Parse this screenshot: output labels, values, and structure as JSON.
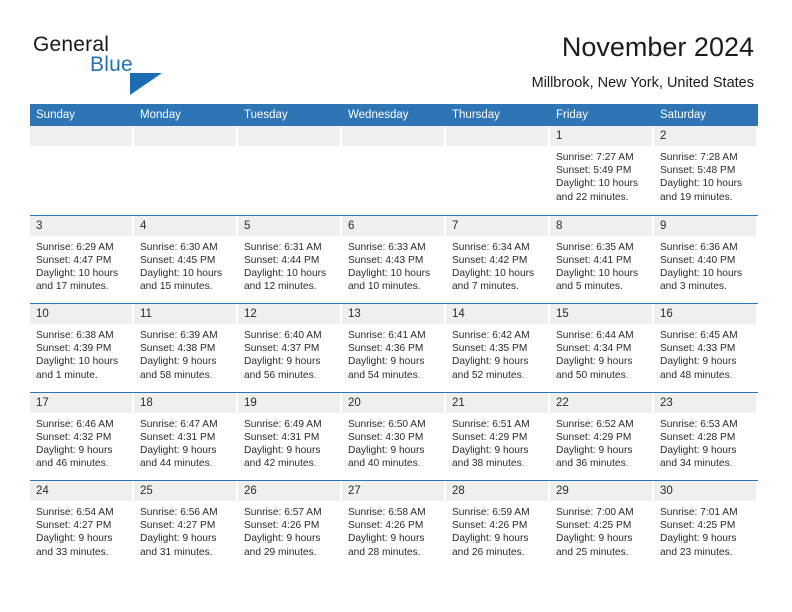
{
  "brand": {
    "name_part1": "General",
    "name_part2": "Blue"
  },
  "header": {
    "title": "November 2024",
    "location": "Millbrook, New York, United States"
  },
  "weekday_headers": [
    "Sunday",
    "Monday",
    "Tuesday",
    "Wednesday",
    "Thursday",
    "Friday",
    "Saturday"
  ],
  "colors": {
    "header_blue": "#2e75b6",
    "brand_blue": "#2272b5",
    "daynum_band": "#efefef",
    "text": "#2b2b2b"
  },
  "weeks": [
    [
      {
        "empty": true
      },
      {
        "empty": true
      },
      {
        "empty": true
      },
      {
        "empty": true
      },
      {
        "empty": true
      },
      {
        "day": "1",
        "sunrise": "Sunrise: 7:27 AM",
        "sunset": "Sunset: 5:49 PM",
        "daylight": "Daylight: 10 hours and 22 minutes."
      },
      {
        "day": "2",
        "sunrise": "Sunrise: 7:28 AM",
        "sunset": "Sunset: 5:48 PM",
        "daylight": "Daylight: 10 hours and 19 minutes."
      }
    ],
    [
      {
        "day": "3",
        "sunrise": "Sunrise: 6:29 AM",
        "sunset": "Sunset: 4:47 PM",
        "daylight": "Daylight: 10 hours and 17 minutes."
      },
      {
        "day": "4",
        "sunrise": "Sunrise: 6:30 AM",
        "sunset": "Sunset: 4:45 PM",
        "daylight": "Daylight: 10 hours and 15 minutes."
      },
      {
        "day": "5",
        "sunrise": "Sunrise: 6:31 AM",
        "sunset": "Sunset: 4:44 PM",
        "daylight": "Daylight: 10 hours and 12 minutes."
      },
      {
        "day": "6",
        "sunrise": "Sunrise: 6:33 AM",
        "sunset": "Sunset: 4:43 PM",
        "daylight": "Daylight: 10 hours and 10 minutes."
      },
      {
        "day": "7",
        "sunrise": "Sunrise: 6:34 AM",
        "sunset": "Sunset: 4:42 PM",
        "daylight": "Daylight: 10 hours and 7 minutes."
      },
      {
        "day": "8",
        "sunrise": "Sunrise: 6:35 AM",
        "sunset": "Sunset: 4:41 PM",
        "daylight": "Daylight: 10 hours and 5 minutes."
      },
      {
        "day": "9",
        "sunrise": "Sunrise: 6:36 AM",
        "sunset": "Sunset: 4:40 PM",
        "daylight": "Daylight: 10 hours and 3 minutes."
      }
    ],
    [
      {
        "day": "10",
        "sunrise": "Sunrise: 6:38 AM",
        "sunset": "Sunset: 4:39 PM",
        "daylight": "Daylight: 10 hours and 1 minute."
      },
      {
        "day": "11",
        "sunrise": "Sunrise: 6:39 AM",
        "sunset": "Sunset: 4:38 PM",
        "daylight": "Daylight: 9 hours and 58 minutes."
      },
      {
        "day": "12",
        "sunrise": "Sunrise: 6:40 AM",
        "sunset": "Sunset: 4:37 PM",
        "daylight": "Daylight: 9 hours and 56 minutes."
      },
      {
        "day": "13",
        "sunrise": "Sunrise: 6:41 AM",
        "sunset": "Sunset: 4:36 PM",
        "daylight": "Daylight: 9 hours and 54 minutes."
      },
      {
        "day": "14",
        "sunrise": "Sunrise: 6:42 AM",
        "sunset": "Sunset: 4:35 PM",
        "daylight": "Daylight: 9 hours and 52 minutes."
      },
      {
        "day": "15",
        "sunrise": "Sunrise: 6:44 AM",
        "sunset": "Sunset: 4:34 PM",
        "daylight": "Daylight: 9 hours and 50 minutes."
      },
      {
        "day": "16",
        "sunrise": "Sunrise: 6:45 AM",
        "sunset": "Sunset: 4:33 PM",
        "daylight": "Daylight: 9 hours and 48 minutes."
      }
    ],
    [
      {
        "day": "17",
        "sunrise": "Sunrise: 6:46 AM",
        "sunset": "Sunset: 4:32 PM",
        "daylight": "Daylight: 9 hours and 46 minutes."
      },
      {
        "day": "18",
        "sunrise": "Sunrise: 6:47 AM",
        "sunset": "Sunset: 4:31 PM",
        "daylight": "Daylight: 9 hours and 44 minutes."
      },
      {
        "day": "19",
        "sunrise": "Sunrise: 6:49 AM",
        "sunset": "Sunset: 4:31 PM",
        "daylight": "Daylight: 9 hours and 42 minutes."
      },
      {
        "day": "20",
        "sunrise": "Sunrise: 6:50 AM",
        "sunset": "Sunset: 4:30 PM",
        "daylight": "Daylight: 9 hours and 40 minutes."
      },
      {
        "day": "21",
        "sunrise": "Sunrise: 6:51 AM",
        "sunset": "Sunset: 4:29 PM",
        "daylight": "Daylight: 9 hours and 38 minutes."
      },
      {
        "day": "22",
        "sunrise": "Sunrise: 6:52 AM",
        "sunset": "Sunset: 4:29 PM",
        "daylight": "Daylight: 9 hours and 36 minutes."
      },
      {
        "day": "23",
        "sunrise": "Sunrise: 6:53 AM",
        "sunset": "Sunset: 4:28 PM",
        "daylight": "Daylight: 9 hours and 34 minutes."
      }
    ],
    [
      {
        "day": "24",
        "sunrise": "Sunrise: 6:54 AM",
        "sunset": "Sunset: 4:27 PM",
        "daylight": "Daylight: 9 hours and 33 minutes."
      },
      {
        "day": "25",
        "sunrise": "Sunrise: 6:56 AM",
        "sunset": "Sunset: 4:27 PM",
        "daylight": "Daylight: 9 hours and 31 minutes."
      },
      {
        "day": "26",
        "sunrise": "Sunrise: 6:57 AM",
        "sunset": "Sunset: 4:26 PM",
        "daylight": "Daylight: 9 hours and 29 minutes."
      },
      {
        "day": "27",
        "sunrise": "Sunrise: 6:58 AM",
        "sunset": "Sunset: 4:26 PM",
        "daylight": "Daylight: 9 hours and 28 minutes."
      },
      {
        "day": "28",
        "sunrise": "Sunrise: 6:59 AM",
        "sunset": "Sunset: 4:26 PM",
        "daylight": "Daylight: 9 hours and 26 minutes."
      },
      {
        "day": "29",
        "sunrise": "Sunrise: 7:00 AM",
        "sunset": "Sunset: 4:25 PM",
        "daylight": "Daylight: 9 hours and 25 minutes."
      },
      {
        "day": "30",
        "sunrise": "Sunrise: 7:01 AM",
        "sunset": "Sunset: 4:25 PM",
        "daylight": "Daylight: 9 hours and 23 minutes."
      }
    ]
  ]
}
